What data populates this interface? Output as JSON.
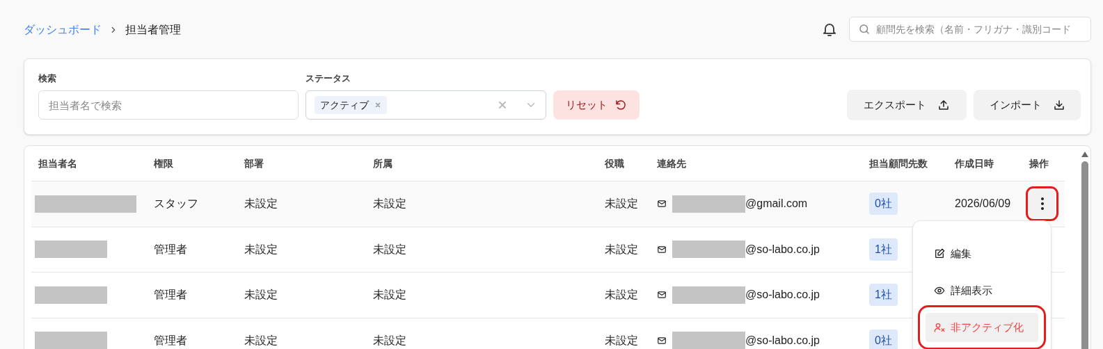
{
  "breadcrumb": [
    {
      "label": "ダッシュボード",
      "link": true
    },
    {
      "label": "担当者管理",
      "link": false
    }
  ],
  "global_search": {
    "placeholder": "顧問先を検索（名前・フリガナ・識別コード"
  },
  "filters": {
    "search": {
      "label": "検索",
      "placeholder": "担当者名で検索"
    },
    "status": {
      "label": "ステータス",
      "tags": [
        "アクティブ"
      ]
    },
    "reset": "リセット",
    "export": "エクスポート",
    "import": "インポート"
  },
  "table": {
    "columns": [
      "担当者名",
      "権限",
      "部署",
      "所属",
      "役職",
      "連絡先",
      "担当顧問先数",
      "作成日時",
      "操作"
    ],
    "rows": [
      {
        "role": "スタッフ",
        "department": "未設定",
        "affiliation": "未設定",
        "position": "未設定",
        "email_domain": "@gmail.com",
        "clients": "0社",
        "created": "2026/06/09",
        "hovered": true,
        "menu_button_highlighted": true
      },
      {
        "role": "管理者",
        "department": "未設定",
        "affiliation": "未設定",
        "position": "未設定",
        "email_domain": "@so-labo.co.jp",
        "clients": "1社",
        "hovered": false
      },
      {
        "role": "管理者",
        "department": "未設定",
        "affiliation": "未設定",
        "position": "未設定",
        "email_domain": "@so-labo.co.jp",
        "clients": "1社",
        "hovered": false
      },
      {
        "role": "管理者",
        "department": "未設定",
        "affiliation": "未設定",
        "position": "未設定",
        "email_domain": "@so-labo.co.jp",
        "clients": "0社",
        "hovered": false
      }
    ]
  },
  "row_menu": {
    "items": [
      {
        "kind": "edit",
        "label": "編集",
        "danger": false,
        "hovered": false,
        "highlighted": false
      },
      {
        "kind": "view",
        "label": "詳細表示",
        "danger": false,
        "hovered": false,
        "highlighted": false
      },
      {
        "kind": "deactivate",
        "label": "非アクティブ化",
        "danger": true,
        "hovered": true,
        "highlighted": true
      }
    ]
  }
}
